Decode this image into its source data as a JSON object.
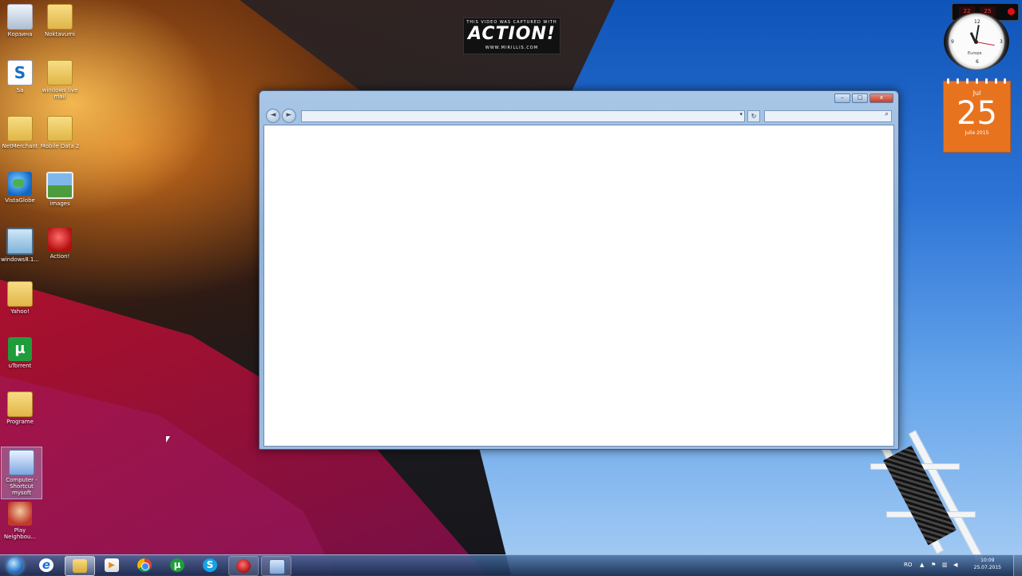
{
  "watermark": {
    "line1": "THIS VIDEO WAS CAPTURED WITH",
    "brand": "ACTION!",
    "line2": "WWW.MIRILLIS.COM"
  },
  "desktop_icons": [
    {
      "label": "Корзина",
      "icon": "recycle-bin-icon"
    },
    {
      "label": "Noktavumi",
      "icon": "folder-icon"
    },
    {
      "label": "Sa",
      "icon": "app-icon"
    },
    {
      "label": "windows live mail",
      "icon": "folder-icon"
    },
    {
      "label": "NetMerchant",
      "icon": "folder-icon"
    },
    {
      "label": "Mobile Data 2",
      "icon": "folder-icon"
    },
    {
      "label": "VistaGlobe",
      "icon": "globe-icon"
    },
    {
      "label": "images",
      "icon": "photo-icon"
    },
    {
      "label": "windows8.1...",
      "icon": "monitor-icon"
    },
    {
      "label": "Action!",
      "icon": "action-icon"
    },
    {
      "label": "Yahoo!",
      "icon": "folder-icon"
    },
    {
      "label": "uTorrent",
      "icon": "utorrent-icon"
    },
    {
      "label": "Programe",
      "icon": "folder-icon"
    },
    {
      "label": "Computer - Shortcut mysoft",
      "icon": "control-icon"
    },
    {
      "label": "Play Neighbou...",
      "icon": "game-icon"
    }
  ],
  "window": {
    "caption": {
      "minimize": "–",
      "maximize": "□",
      "close": "x"
    },
    "back": "◄",
    "forward": "►",
    "address_value": "",
    "address_dropdown": "▾",
    "refresh": "↻",
    "search_value": "",
    "search_icon": "⌕"
  },
  "gadgets": {
    "clock": {
      "city": "Europe"
    },
    "calendar": {
      "month": "Jul",
      "day": "25",
      "month_year": "Julie 2015"
    },
    "meter": {
      "cpu": "22",
      "mem": "25"
    }
  },
  "taskbar": {
    "items": [
      {
        "name": "ie-icon",
        "glyph": "e"
      },
      {
        "name": "explorer-icon",
        "glyph": ""
      },
      {
        "name": "media-player-icon",
        "glyph": "▶"
      },
      {
        "name": "chrome-icon",
        "glyph": ""
      },
      {
        "name": "utorrent-icon",
        "glyph": "µ"
      },
      {
        "name": "skype-icon",
        "glyph": "S"
      },
      {
        "name": "action-icon",
        "glyph": ""
      },
      {
        "name": "window-icon",
        "glyph": ""
      }
    ],
    "tray": {
      "lang": "RO",
      "time": "10:09",
      "date": "25.07.2015"
    }
  }
}
